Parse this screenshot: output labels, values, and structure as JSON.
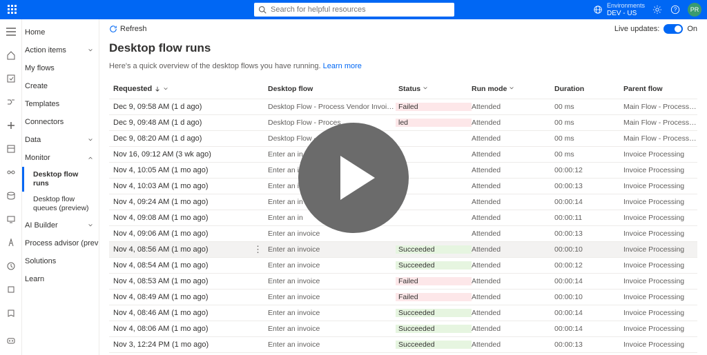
{
  "header": {
    "search_placeholder": "Search for helpful resources",
    "env_label": "Environments",
    "env_name": "DEV - US",
    "avatar_initials": "PR"
  },
  "sidebar": {
    "items": [
      {
        "label": "Home"
      },
      {
        "label": "Action items"
      },
      {
        "label": "My flows"
      },
      {
        "label": "Create"
      },
      {
        "label": "Templates"
      },
      {
        "label": "Connectors"
      },
      {
        "label": "Data"
      },
      {
        "label": "Monitor"
      },
      {
        "label": "Desktop flow runs"
      },
      {
        "label": "Desktop flow queues (preview)"
      },
      {
        "label": "AI Builder"
      },
      {
        "label": "Process advisor (preview)"
      },
      {
        "label": "Solutions"
      },
      {
        "label": "Learn"
      }
    ]
  },
  "toolbar": {
    "refresh": "Refresh",
    "live_updates": "Live updates:",
    "toggle_state": "On"
  },
  "page": {
    "title": "Desktop flow runs",
    "subtitle_text": "Here's a quick overview of the desktop flows you have running. ",
    "subtitle_link": "Learn more"
  },
  "columns": {
    "requested": "Requested",
    "flow": "Desktop flow",
    "status": "Status",
    "run": "Run mode",
    "dur": "Duration",
    "parent": "Parent flow"
  },
  "rows": [
    {
      "req": "Dec 9, 09:58 AM (1 d ago)",
      "flow": "Desktop Flow - Process Vendor Invoices",
      "status": "Failed",
      "run": "Attended",
      "dur": "00 ms",
      "parent": "Main Flow - Process AI Builder Docu..."
    },
    {
      "req": "Dec 9, 09:48 AM (1 d ago)",
      "flow": "Desktop Flow - Proces",
      "status": "led",
      "run": "Attended",
      "dur": "00 ms",
      "parent": "Main Flow - Process AI Builder Docu..."
    },
    {
      "req": "Dec 9, 08:20 AM (1 d ago)",
      "flow": "Desktop Flow -",
      "status": "",
      "run": "Attended",
      "dur": "00 ms",
      "parent": "Main Flow - Process AI Builder Docu..."
    },
    {
      "req": "Nov 16, 09:12 AM (3 wk ago)",
      "flow": "Enter an in",
      "status": "",
      "run": "Attended",
      "dur": "00 ms",
      "parent": "Invoice Processing"
    },
    {
      "req": "Nov 4, 10:05 AM (1 mo ago)",
      "flow": "Enter an i",
      "status": "",
      "run": "Attended",
      "dur": "00:00:12",
      "parent": "Invoice Processing"
    },
    {
      "req": "Nov 4, 10:03 AM (1 mo ago)",
      "flow": "Enter an i",
      "status": "",
      "run": "Attended",
      "dur": "00:00:13",
      "parent": "Invoice Processing"
    },
    {
      "req": "Nov 4, 09:24 AM (1 mo ago)",
      "flow": "Enter an in",
      "status": "",
      "run": "Attended",
      "dur": "00:00:14",
      "parent": "Invoice Processing"
    },
    {
      "req": "Nov 4, 09:08 AM (1 mo ago)",
      "flow": "Enter an in",
      "status": "",
      "run": "Attended",
      "dur": "00:00:11",
      "parent": "Invoice Processing"
    },
    {
      "req": "Nov 4, 09:06 AM (1 mo ago)",
      "flow": "Enter an invoice",
      "status": "",
      "run": "Attended",
      "dur": "00:00:13",
      "parent": "Invoice Processing"
    },
    {
      "req": "Nov 4, 08:56 AM (1 mo ago)",
      "flow": "Enter an invoice",
      "status": "Succeeded",
      "run": "Attended",
      "dur": "00:00:10",
      "parent": "Invoice Processing",
      "hovered": true
    },
    {
      "req": "Nov 4, 08:54 AM (1 mo ago)",
      "flow": "Enter an invoice",
      "status": "Succeeded",
      "run": "Attended",
      "dur": "00:00:12",
      "parent": "Invoice Processing"
    },
    {
      "req": "Nov 4, 08:53 AM (1 mo ago)",
      "flow": "Enter an invoice",
      "status": "Failed",
      "run": "Attended",
      "dur": "00:00:14",
      "parent": "Invoice Processing"
    },
    {
      "req": "Nov 4, 08:49 AM (1 mo ago)",
      "flow": "Enter an invoice",
      "status": "Failed",
      "run": "Attended",
      "dur": "00:00:10",
      "parent": "Invoice Processing"
    },
    {
      "req": "Nov 4, 08:46 AM (1 mo ago)",
      "flow": "Enter an invoice",
      "status": "Succeeded",
      "run": "Attended",
      "dur": "00:00:14",
      "parent": "Invoice Processing"
    },
    {
      "req": "Nov 4, 08:06 AM (1 mo ago)",
      "flow": "Enter an invoice",
      "status": "Succeeded",
      "run": "Attended",
      "dur": "00:00:14",
      "parent": "Invoice Processing"
    },
    {
      "req": "Nov 3, 12:24 PM (1 mo ago)",
      "flow": "Enter an invoice",
      "status": "Succeeded",
      "run": "Attended",
      "dur": "00:00:13",
      "parent": "Invoice Processing"
    }
  ]
}
